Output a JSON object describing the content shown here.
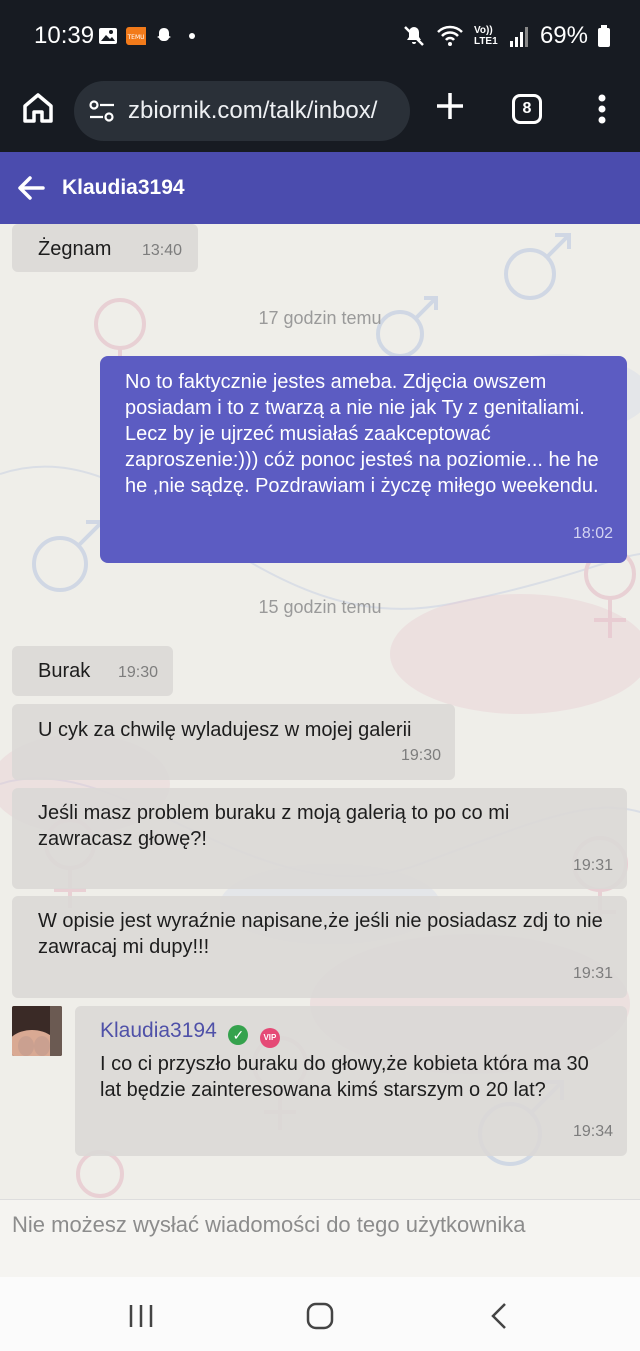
{
  "status_bar": {
    "time": "10:39",
    "volte_label": "Vo)) LTE1",
    "battery": "69%"
  },
  "browser": {
    "url": "zbiornik.com/talk/inbox/",
    "tab_count": "8"
  },
  "header": {
    "title": "Klaudia3194"
  },
  "messages": [
    {
      "dir": "in",
      "text": "Żegnam",
      "time": "13:40"
    },
    {
      "dir": "out",
      "text": "No to faktycznie jestes ameba. Zdjęcia owszem posiadam i to z twarzą a nie nie jak Ty z genitaliami. Lecz by je ujrzeć musiałaś zaakceptować zaproszenie:))) cóż ponoc jesteś na poziomie... he he he ,nie sądzę. Pozdrawiam i życzę miłego weekendu.",
      "time": "18:02"
    },
    {
      "dir": "in",
      "text": "Burak",
      "time": "19:30"
    },
    {
      "dir": "in",
      "text": "U cyk za chwilę wyladujesz w mojej galerii",
      "time": "19:30"
    },
    {
      "dir": "in",
      "text": "Jeśli masz problem buraku z moją galerią to po co mi zawracasz głowę?!",
      "time": "19:31"
    },
    {
      "dir": "in",
      "text": "W opisie jest wyraźnie napisane,że jeśli nie posiadasz zdj to nie zawracaj mi dupy!!!",
      "time": "19:31"
    },
    {
      "dir": "in",
      "sender": "Klaudia3194",
      "vip_label": "VIP",
      "text": "I co ci przyszło buraku do głowy,że kobieta która ma 30 lat będzie zainteresowana kimś starszym o 20 lat?",
      "time": "19:34"
    }
  ],
  "dividers": [
    "17 godzin temu",
    "15 godzin temu"
  ],
  "footer": {
    "notice": "Nie możesz wysłać wiadomości do tego użytkownika"
  },
  "colors": {
    "header": "#4b4cae",
    "outgoing_bubble": "#5c5cc2",
    "incoming_bubble": "#dad8d6",
    "chat_bg": "#efeee9"
  },
  "icons": [
    "image-icon",
    "temu-icon",
    "snapchat-icon",
    "mute-icon",
    "wifi-icon",
    "signal-icon",
    "battery-icon",
    "home-icon",
    "site-settings-icon",
    "plus-icon",
    "tabs-icon",
    "more-vert-icon",
    "back-arrow-icon",
    "recents-icon",
    "home-nav-icon",
    "back-nav-icon"
  ]
}
